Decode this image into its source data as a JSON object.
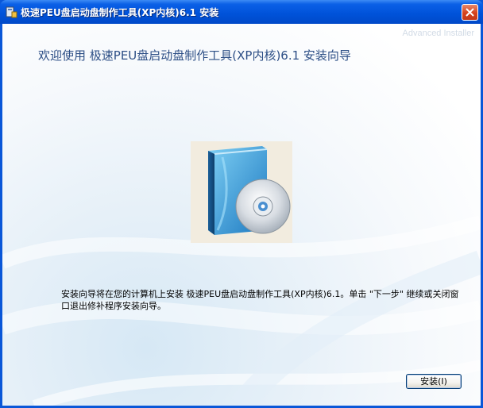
{
  "window": {
    "title": "极速PEU盘启动盘制作工具(XP内核)6.1 安装",
    "app_icon": "installer-icon",
    "close_icon": "close-icon"
  },
  "branding": {
    "watermark": "Advanced Installer"
  },
  "main": {
    "heading": "欢迎使用 极速PEU盘启动盘制作工具(XP内核)6.1 安装向导",
    "product_image": "software-box-with-cd",
    "description": "安装向导将在您的计算机上安装 极速PEU盘启动盘制作工具(XP内核)6.1。单击 \"下一步\" 继续或关闭窗口退出修补程序安装向导。"
  },
  "buttons": {
    "install_label": "安装(I)"
  },
  "colors": {
    "titlebar": "#0052d9",
    "heading": "#2d4f86",
    "close_button": "#d5421c"
  }
}
